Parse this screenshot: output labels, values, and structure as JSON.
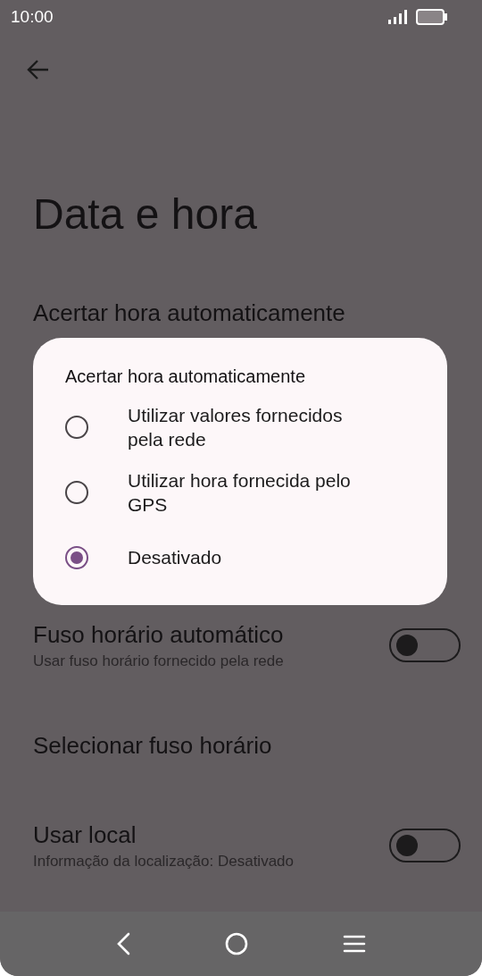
{
  "status_bar": {
    "time": "10:00"
  },
  "page": {
    "title": "Data e hora"
  },
  "settings": [
    {
      "kind": "plain",
      "label": "Acertar hora automaticamente"
    },
    {
      "kind": "hidden"
    },
    {
      "kind": "toggle",
      "label": "Fuso horário automático",
      "subtitle": "Usar fuso horário fornecido pela rede",
      "on": false
    },
    {
      "kind": "plain",
      "label": "Selecionar fuso horário"
    },
    {
      "kind": "toggle",
      "label": "Usar local",
      "subtitle": "Informação da localização: Desativado",
      "on": false
    }
  ],
  "dialog": {
    "title": "Acertar hora automaticamente",
    "options": [
      {
        "label": "Utilizar valores fornecidos pela rede",
        "selected": false
      },
      {
        "label": "Utilizar hora fornecida pelo GPS",
        "selected": false
      },
      {
        "label": "Desativado",
        "selected": true
      }
    ]
  }
}
